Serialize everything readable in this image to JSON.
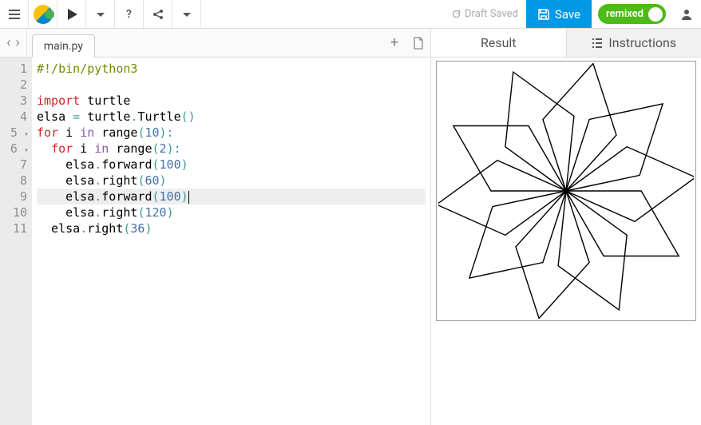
{
  "toolbar": {
    "draft_status": "Draft Saved",
    "save_label": "Save",
    "remix_label": "remixed"
  },
  "editor": {
    "filename": "main.py",
    "active_line": 9,
    "lines": [
      {
        "n": 1,
        "tokens": [
          {
            "t": "#!/bin/python3",
            "c": "c-cm"
          }
        ]
      },
      {
        "n": 2,
        "tokens": []
      },
      {
        "n": 3,
        "tokens": [
          {
            "t": "import",
            "c": "c-kw"
          },
          {
            "t": " turtle",
            "c": "c-id"
          }
        ]
      },
      {
        "n": 4,
        "tokens": [
          {
            "t": "elsa ",
            "c": "c-id"
          },
          {
            "t": "=",
            "c": "c-op"
          },
          {
            "t": " turtle",
            "c": "c-id"
          },
          {
            "t": ".",
            "c": "c-op"
          },
          {
            "t": "Turtle",
            "c": "c-fn"
          },
          {
            "t": "()",
            "c": "c-op"
          }
        ]
      },
      {
        "n": 5,
        "fold": true,
        "tokens": [
          {
            "t": "for",
            "c": "c-kw"
          },
          {
            "t": " i ",
            "c": "c-id"
          },
          {
            "t": "in",
            "c": "c-kw2"
          },
          {
            "t": " ",
            "c": ""
          },
          {
            "t": "range",
            "c": "c-fn"
          },
          {
            "t": "(",
            "c": "c-op"
          },
          {
            "t": "10",
            "c": "c-nm"
          },
          {
            "t": "):",
            "c": "c-op"
          }
        ]
      },
      {
        "n": 6,
        "fold": true,
        "tokens": [
          {
            "t": "  ",
            "c": ""
          },
          {
            "t": "for",
            "c": "c-kw"
          },
          {
            "t": " i ",
            "c": "c-id"
          },
          {
            "t": "in",
            "c": "c-kw2"
          },
          {
            "t": " ",
            "c": ""
          },
          {
            "t": "range",
            "c": "c-fn"
          },
          {
            "t": "(",
            "c": "c-op"
          },
          {
            "t": "2",
            "c": "c-nm"
          },
          {
            "t": "):",
            "c": "c-op"
          }
        ]
      },
      {
        "n": 7,
        "tokens": [
          {
            "t": "    elsa",
            "c": "c-id"
          },
          {
            "t": ".",
            "c": "c-op"
          },
          {
            "t": "forward",
            "c": "c-fn"
          },
          {
            "t": "(",
            "c": "c-op"
          },
          {
            "t": "100",
            "c": "c-nm"
          },
          {
            "t": ")",
            "c": "c-op"
          }
        ]
      },
      {
        "n": 8,
        "tokens": [
          {
            "t": "    elsa",
            "c": "c-id"
          },
          {
            "t": ".",
            "c": "c-op"
          },
          {
            "t": "right",
            "c": "c-fn"
          },
          {
            "t": "(",
            "c": "c-op"
          },
          {
            "t": "60",
            "c": "c-nm"
          },
          {
            "t": ")",
            "c": "c-op"
          }
        ]
      },
      {
        "n": 9,
        "tokens": [
          {
            "t": "    elsa",
            "c": "c-id"
          },
          {
            "t": ".",
            "c": "c-op"
          },
          {
            "t": "forward",
            "c": "c-fn"
          },
          {
            "t": "(",
            "c": "c-op"
          },
          {
            "t": "100",
            "c": "c-nm"
          },
          {
            "t": ")",
            "c": "c-op"
          }
        ]
      },
      {
        "n": 10,
        "tokens": [
          {
            "t": "    elsa",
            "c": "c-id"
          },
          {
            "t": ".",
            "c": "c-op"
          },
          {
            "t": "right",
            "c": "c-fn"
          },
          {
            "t": "(",
            "c": "c-op"
          },
          {
            "t": "120",
            "c": "c-nm"
          },
          {
            "t": ")",
            "c": "c-op"
          }
        ]
      },
      {
        "n": 11,
        "tokens": [
          {
            "t": "  elsa",
            "c": "c-id"
          },
          {
            "t": ".",
            "c": "c-op"
          },
          {
            "t": "right",
            "c": "c-fn"
          },
          {
            "t": "(",
            "c": "c-op"
          },
          {
            "t": "36",
            "c": "c-nm"
          },
          {
            "t": ")",
            "c": "c-op"
          }
        ]
      }
    ]
  },
  "output": {
    "tab_result": "Result",
    "tab_instructions": "Instructions",
    "turtle": {
      "scale": 1.0,
      "reps_outer": 10,
      "reps_inner": 2,
      "fwd1": 100,
      "right1": 60,
      "fwd2": 100,
      "right2": 120,
      "right_outer": 36
    }
  }
}
